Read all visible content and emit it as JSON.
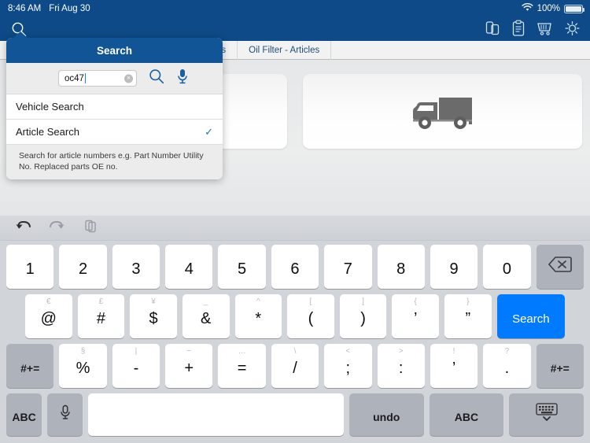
{
  "statusbar": {
    "time": "8:46 AM",
    "date": "Fri Aug 30",
    "battery_pct": "100%",
    "wifi_icon": "wifi-icon",
    "battery_icon": "battery-icon"
  },
  "header": {
    "search_icon": "search-icon",
    "icons": [
      {
        "name": "compare-parts-icon",
        "label": "Compare"
      },
      {
        "name": "clipboard-icon",
        "label": "Notes"
      },
      {
        "name": "shopping-cart-icon",
        "label": "Cart"
      },
      {
        "name": "gear-icon",
        "label": "Settings"
      }
    ]
  },
  "tabs": [
    {
      "label": "ters",
      "active": false
    },
    {
      "label": "Oil Filter - Articles",
      "active": true
    }
  ],
  "content": {
    "cards": [
      {
        "name": "passenger-car-card",
        "icon": "car-icon"
      },
      {
        "name": "truck-card",
        "icon": "truck-icon"
      }
    ]
  },
  "popover": {
    "title": "Search",
    "input": {
      "value": "oc47",
      "placeholder": "",
      "clear_label": "×"
    },
    "search_icon": "search-icon",
    "mic_icon": "microphone-icon",
    "options": [
      {
        "label": "Vehicle Search",
        "selected": false,
        "check": ""
      },
      {
        "label": "Article Search",
        "selected": true,
        "check": "✓"
      }
    ],
    "hint": "Search for article numbers e.g. Part Number Utility No. Replaced parts OE no."
  },
  "keyboard": {
    "toolbar": [
      {
        "name": "undo-icon",
        "enabled": true
      },
      {
        "name": "redo-icon",
        "enabled": false
      },
      {
        "name": "paste-icon",
        "enabled": false
      }
    ],
    "row1": [
      {
        "main": "1",
        "sub": ""
      },
      {
        "main": "2",
        "sub": ""
      },
      {
        "main": "3",
        "sub": ""
      },
      {
        "main": "4",
        "sub": ""
      },
      {
        "main": "5",
        "sub": ""
      },
      {
        "main": "6",
        "sub": ""
      },
      {
        "main": "7",
        "sub": ""
      },
      {
        "main": "8",
        "sub": ""
      },
      {
        "main": "9",
        "sub": ""
      },
      {
        "main": "0",
        "sub": ""
      }
    ],
    "backspace": {
      "name": "backspace-key",
      "icon": "backspace-icon"
    },
    "row2": [
      {
        "main": "@",
        "sub": "€"
      },
      {
        "main": "#",
        "sub": "£"
      },
      {
        "main": "$",
        "sub": "¥"
      },
      {
        "main": "&",
        "sub": "_"
      },
      {
        "main": "*",
        "sub": "^"
      },
      {
        "main": "(",
        "sub": "["
      },
      {
        "main": ")",
        "sub": "]"
      },
      {
        "main": "’",
        "sub": "{"
      },
      {
        "main": "”",
        "sub": "}"
      }
    ],
    "search_key": {
      "label": "Search"
    },
    "row3": [
      {
        "main": "%",
        "sub": "§"
      },
      {
        "main": "-",
        "sub": "|"
      },
      {
        "main": "+",
        "sub": "~"
      },
      {
        "main": "=",
        "sub": "…"
      },
      {
        "main": "/",
        "sub": "\\"
      },
      {
        "main": ";",
        "sub": "<"
      },
      {
        "main": ":",
        "sub": ">"
      },
      {
        "main": "’",
        "sub": "!"
      },
      {
        "main": ".",
        "sub": "?"
      }
    ],
    "shift_left": {
      "label": "#+="
    },
    "shift_right": {
      "label": "#+="
    },
    "row4": {
      "abc_left": {
        "label": "ABC"
      },
      "mic": {
        "name": "microphone-key",
        "icon": "microphone-icon"
      },
      "space": {
        "label": ""
      },
      "undo": {
        "label": "undo"
      },
      "abc_right": {
        "label": "ABC"
      },
      "hide": {
        "name": "hide-keyboard-key",
        "icon": "hide-keyboard-icon"
      }
    }
  },
  "colors": {
    "header_blue": "#0d4a87",
    "popover_blue": "#115596",
    "accent_blue": "#007aff",
    "keyboard_bg": "#d1d4d9"
  }
}
